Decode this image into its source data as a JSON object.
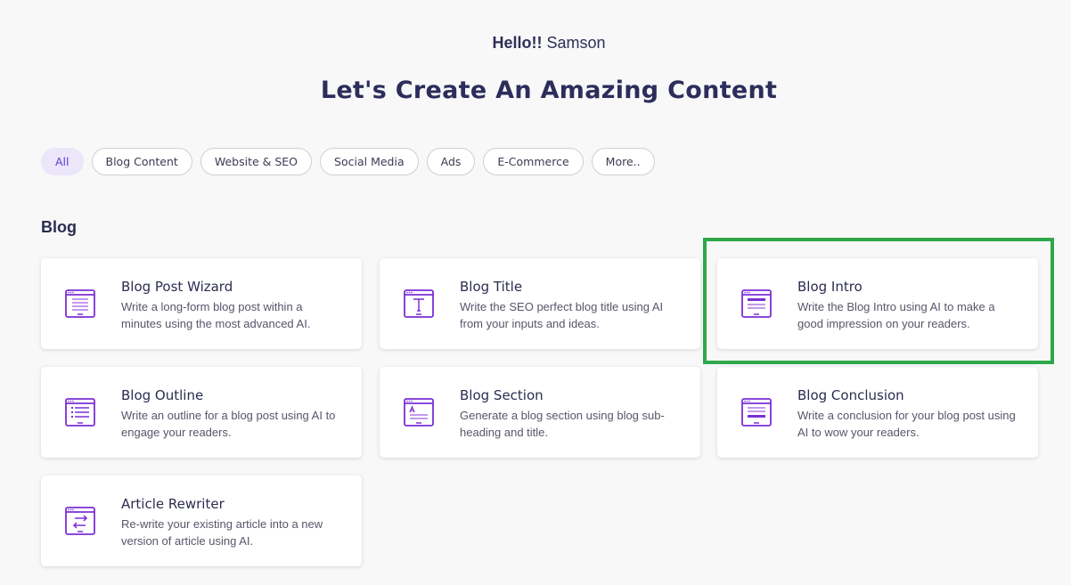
{
  "header": {
    "greeting_bold": "Hello!!",
    "greeting_name": "Samson",
    "headline": "Let's Create An Amazing Content"
  },
  "filters": [
    {
      "label": "All",
      "active": true
    },
    {
      "label": "Blog Content",
      "active": false
    },
    {
      "label": "Website & SEO",
      "active": false
    },
    {
      "label": "Social Media",
      "active": false
    },
    {
      "label": "Ads",
      "active": false
    },
    {
      "label": "E-Commerce",
      "active": false
    },
    {
      "label": "More..",
      "active": false
    }
  ],
  "section": {
    "title": "Blog"
  },
  "cards": [
    {
      "title": "Blog Post Wizard",
      "desc": "Write a long-form blog post within a minutes using the most advanced AI.",
      "icon": "document-lines-icon"
    },
    {
      "title": "Blog Title",
      "desc": "Write the SEO perfect blog title using AI from your inputs and ideas.",
      "icon": "text-title-icon"
    },
    {
      "title": "Blog Intro",
      "desc": "Write the Blog Intro using AI to make a good impression on your readers.",
      "icon": "intro-document-icon"
    },
    {
      "title": "Blog Outline",
      "desc": "Write an outline for a blog post using AI to engage your readers.",
      "icon": "bullet-list-icon"
    },
    {
      "title": "Blog Section",
      "desc": "Generate a blog section using blog sub-heading and title.",
      "icon": "section-document-icon"
    },
    {
      "title": "Blog Conclusion",
      "desc": "Write a conclusion for your blog post using AI to wow your readers.",
      "icon": "conclusion-document-icon"
    },
    {
      "title": "Article Rewriter",
      "desc": "Re-write your existing article into a new version of article using AI.",
      "icon": "swap-arrows-icon"
    }
  ],
  "colors": {
    "accent": "#7b2fd6",
    "highlight": "#2ea84a",
    "chip_active_bg": "#ebe6fa"
  }
}
